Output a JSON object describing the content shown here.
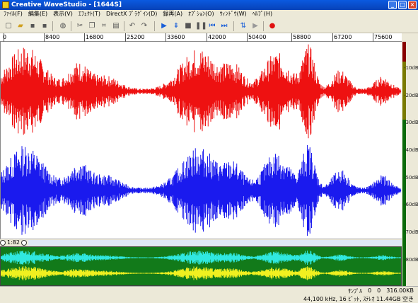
{
  "window": {
    "title": "Creative WaveStudio - [1644S]"
  },
  "menu": [
    "ﾌｧｲﾙ(F)",
    "編集(E)",
    "表示(V)",
    "ｴﾌｪｸﾄ(T)",
    "DirectX ﾌﾟﾗｸﾞｲﾝ(D)",
    "録再(A)",
    "ｵﾌﾟｼｮﾝ(O)",
    "ｳｨﾝﾄﾞｳ(W)",
    "ﾍﾙﾌﾟ(H)"
  ],
  "ruler": [
    "0",
    "8400",
    "16800",
    "25200",
    "33600",
    "42000",
    "50400",
    "58800",
    "67200",
    "75600"
  ],
  "zoom": {
    "value": "1:82"
  },
  "vu_labels": [
    "-10dB",
    "-20dB",
    "-30dB",
    "-40dB",
    "-50dB",
    "-60dB",
    "-70dB",
    "-80dB"
  ],
  "status": {
    "row1": [
      "ｻﾝﾌﾟﾙ",
      "0",
      "0",
      "316.00KB"
    ],
    "row2": "44,100 kHz, 16 ﾋﾞｯﾄ, ｽﾃﾚｵ   11.44GB 空き"
  },
  "colors": {
    "left": "#ee1111",
    "right": "#1a1aee",
    "ov_left": "#30e8e0",
    "ov_right": "#f0f020",
    "ov_bg": "#127a1a"
  }
}
